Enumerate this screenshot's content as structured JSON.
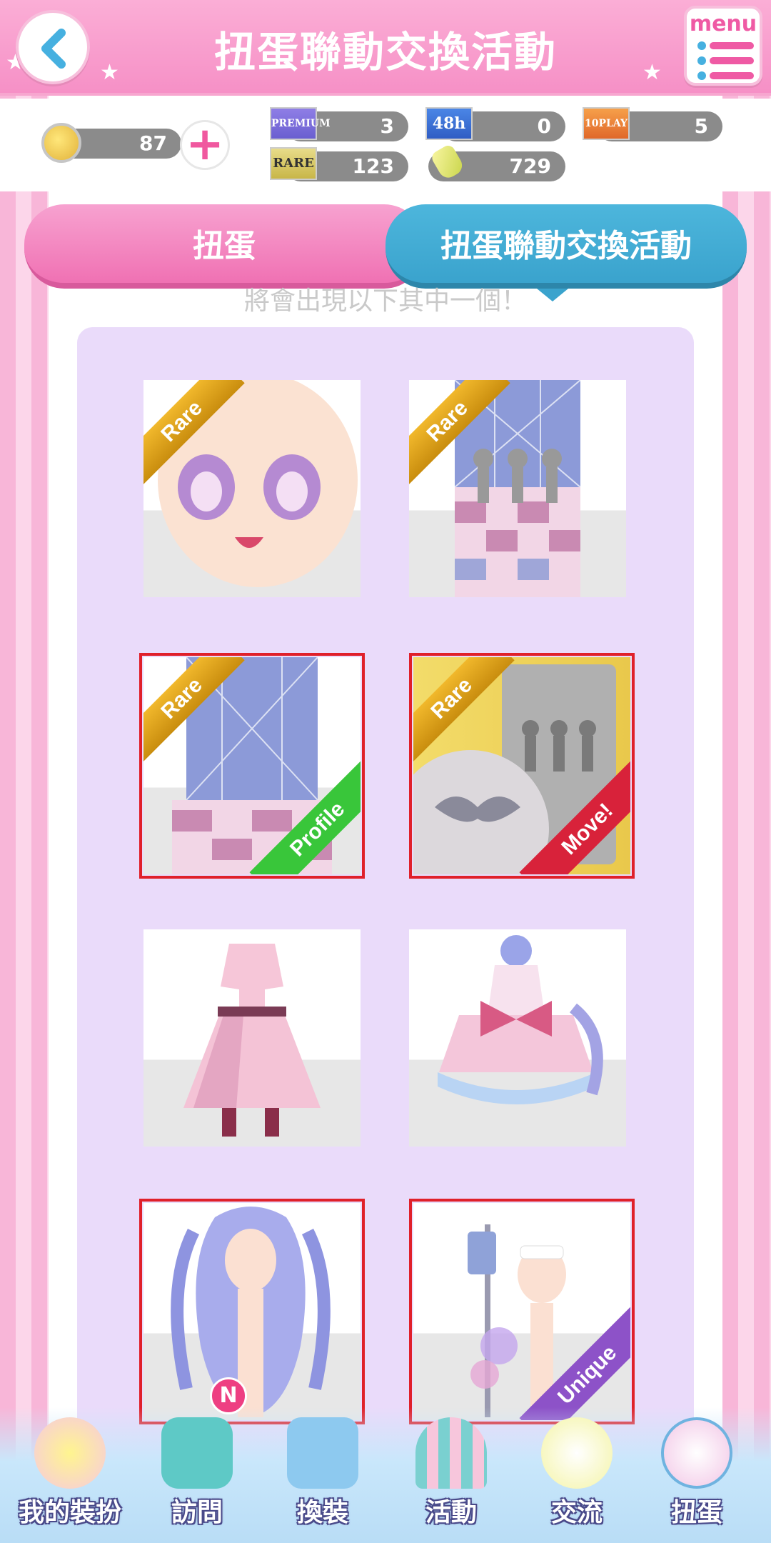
{
  "header": {
    "title": "扭蛋聯動交換活動",
    "menu_label": "menu"
  },
  "currency": {
    "coins": "87",
    "premium_tickets": "3",
    "ticket_48h": "0",
    "ticket_10play": "5",
    "rare_tickets": "123",
    "gems": "729",
    "premium_icon_text": "PREMIUM",
    "rare_icon_text": "RARE",
    "h48_icon_text": "48h",
    "play10_icon_text": "10PLAY"
  },
  "tabs": {
    "gacha": "扭蛋",
    "event": "扭蛋聯動交換活動"
  },
  "subtitle": "將會出現以下其中一個！",
  "items": [
    {
      "ribbon": "Rare",
      "corner": "",
      "kind": "face"
    },
    {
      "ribbon": "Rare",
      "corner": "",
      "kind": "background"
    },
    {
      "ribbon": "Rare",
      "corner": "Profile",
      "kind": "profile-background"
    },
    {
      "ribbon": "Rare",
      "corner": "Move!",
      "kind": "moving-background"
    },
    {
      "ribbon": "",
      "corner": "",
      "kind": "pink-coat-dress"
    },
    {
      "ribbon": "",
      "corner": "",
      "kind": "ruffle-dress"
    },
    {
      "ribbon": "",
      "corner": "",
      "kind": "lavender-twin-hair"
    },
    {
      "ribbon": "",
      "corner": "Unique",
      "kind": "nurse-iv-stand"
    }
  ],
  "nav": {
    "my_outfit": "我的裝扮",
    "visit": "訪問",
    "visit_badge": "N",
    "dress_up": "換裝",
    "event": "活動",
    "social": "交流",
    "gacha": "扭蛋"
  },
  "colors": {
    "header_pink": "#f690c6",
    "tab_blue": "#3aa3cd",
    "tab_pink": "#f071b3",
    "panel_lavender": "#eadbfa"
  }
}
